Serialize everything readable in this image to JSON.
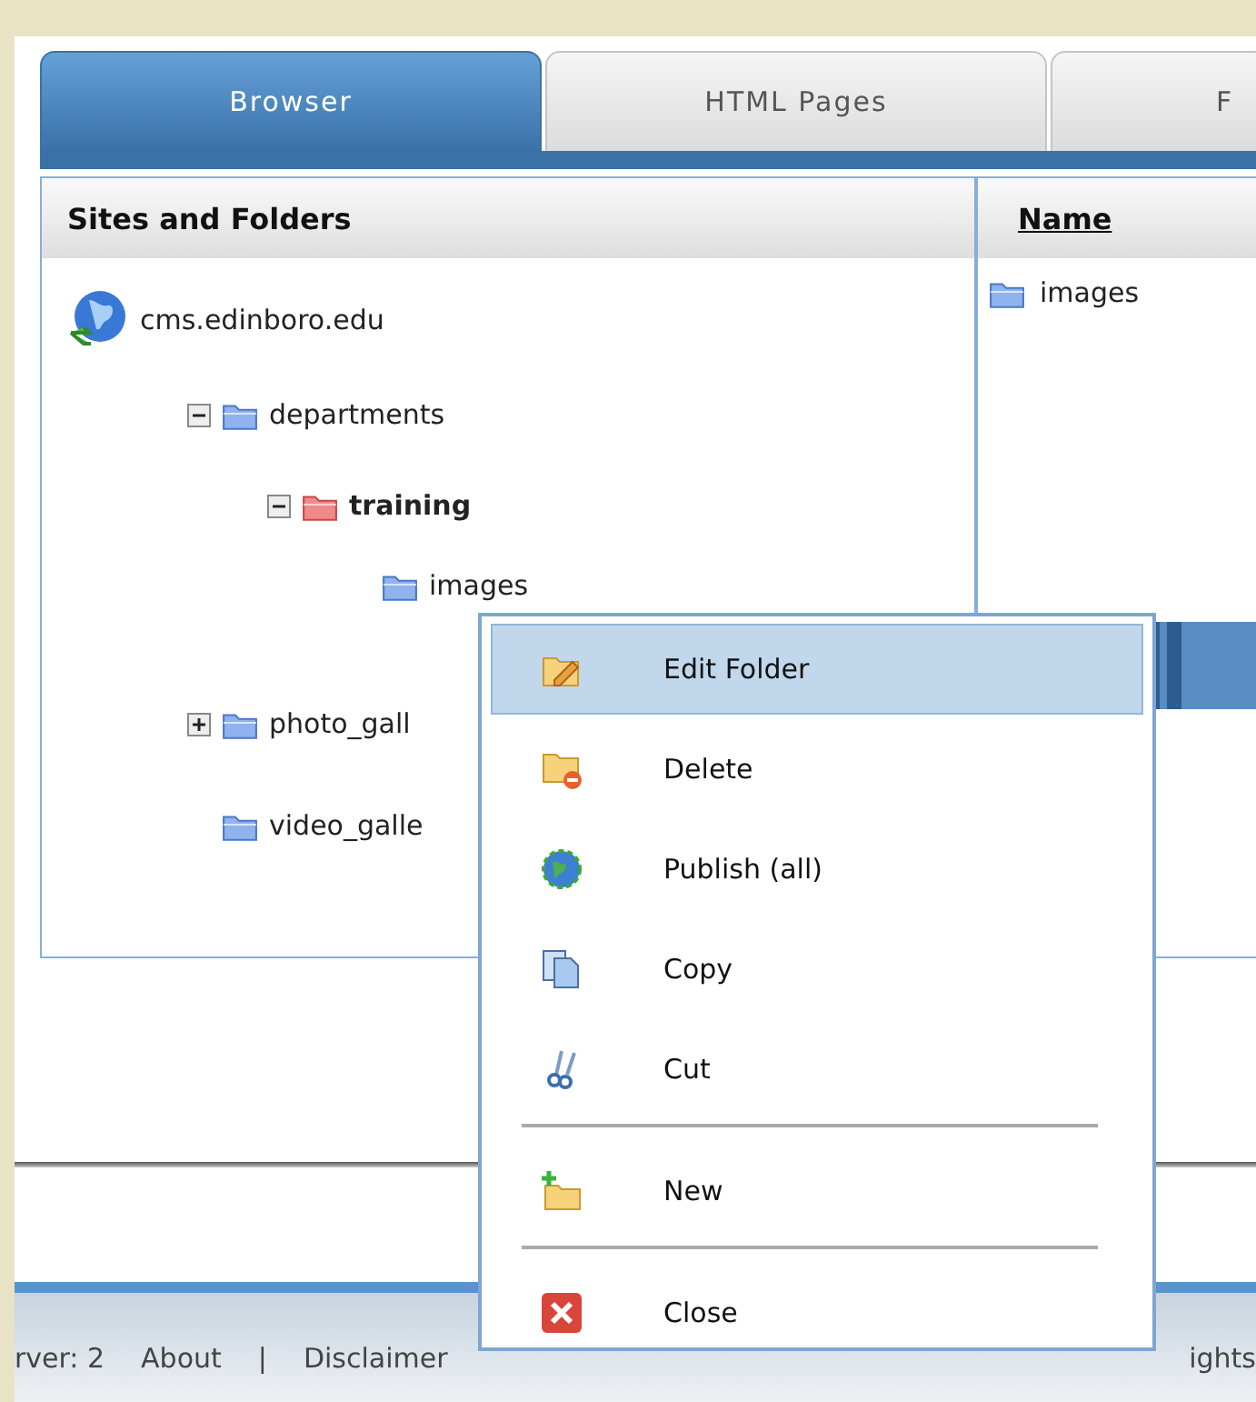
{
  "tabs": [
    {
      "label": "Browser",
      "selected": true
    },
    {
      "label": "HTML Pages",
      "selected": false
    },
    {
      "label": "F",
      "selected": false
    }
  ],
  "tree_pane": {
    "header": "Sites and Folders",
    "root": {
      "label": "cms.edinboro.edu",
      "children": [
        {
          "label": "departments",
          "expanded": true,
          "selected": false,
          "children": [
            {
              "label": "training",
              "expanded": true,
              "selected": true,
              "children": [
                {
                  "label": "images",
                  "selected": false
                }
              ]
            }
          ]
        },
        {
          "label": "photo_gall",
          "expanded": false,
          "selected": false
        },
        {
          "label": "video_galle",
          "selected": false
        }
      ]
    }
  },
  "content_pane": {
    "column": "Name",
    "rows": [
      {
        "label": "images"
      }
    ]
  },
  "context_menu": [
    {
      "label": "Edit Folder",
      "kind": "edit",
      "selected": true,
      "separator_before": false
    },
    {
      "label": "Delete",
      "kind": "delete",
      "selected": false,
      "separator_before": false
    },
    {
      "label": "Publish (all)",
      "kind": "publish",
      "selected": false,
      "separator_before": false
    },
    {
      "label": "Copy",
      "kind": "copy",
      "selected": false,
      "separator_before": false
    },
    {
      "label": "Cut",
      "kind": "cut",
      "selected": false,
      "separator_before": false
    },
    {
      "label": "New",
      "kind": "new",
      "selected": false,
      "separator_before": true
    },
    {
      "label": "Close",
      "kind": "close",
      "selected": false,
      "separator_before": true
    }
  ],
  "footer": {
    "left": [
      "rver: 2",
      "About",
      "|",
      "Disclaimer"
    ],
    "right": "ights"
  }
}
